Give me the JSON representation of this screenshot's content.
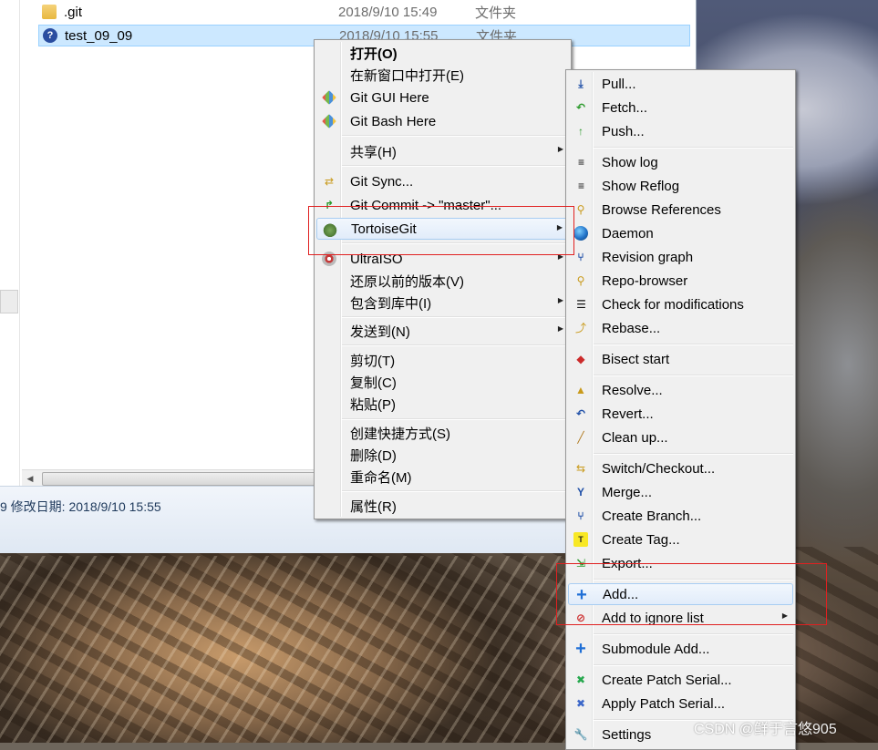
{
  "explorer": {
    "files": [
      {
        "name": ".git",
        "date": "2018/9/10 15:49",
        "type": "文件夹",
        "icon": "folder-icon"
      },
      {
        "name": "test_09_09",
        "date": "2018/9/10 15:55",
        "type": "文件夹",
        "icon": "git-file-icon"
      }
    ],
    "details_text": "9  修改日期: 2018/9/10 15:55"
  },
  "context_menu": {
    "items": [
      {
        "label": "打开(O)",
        "bold": true
      },
      {
        "label": "在新窗口中打开(E)"
      },
      {
        "label": "Git GUI Here",
        "icon": "git-gui-icon"
      },
      {
        "label": "Git Bash Here",
        "icon": "git-bash-icon"
      },
      {
        "label": "共享(H)",
        "submenu": true
      },
      {
        "label": "Git Sync...",
        "icon": "git-sync-icon"
      },
      {
        "label": "Git Commit -> \"master\"...",
        "icon": "git-commit-icon"
      },
      {
        "label": "TortoiseGit",
        "icon": "tortoisegit-icon",
        "submenu": true,
        "highlighted": true
      },
      {
        "label": "UltraISO",
        "icon": "ultraiso-icon",
        "submenu": true
      },
      {
        "label": "还原以前的版本(V)"
      },
      {
        "label": "包含到库中(I)",
        "submenu": true
      },
      {
        "label": "发送到(N)",
        "submenu": true
      },
      {
        "label": "剪切(T)"
      },
      {
        "label": "复制(C)"
      },
      {
        "label": "粘贴(P)"
      },
      {
        "label": "创建快捷方式(S)"
      },
      {
        "label": "删除(D)"
      },
      {
        "label": "重命名(M)"
      },
      {
        "label": "属性(R)"
      }
    ]
  },
  "tortoisegit_menu": {
    "items": [
      {
        "label": "Pull...",
        "icon": "pull-icon"
      },
      {
        "label": "Fetch...",
        "icon": "fetch-icon"
      },
      {
        "label": "Push...",
        "icon": "push-icon"
      },
      {
        "label": "Show log",
        "icon": "show-log-icon"
      },
      {
        "label": "Show Reflog",
        "icon": "show-reflog-icon"
      },
      {
        "label": "Browse References",
        "icon": "browse-references-icon"
      },
      {
        "label": "Daemon",
        "icon": "daemon-globe-icon"
      },
      {
        "label": "Revision graph",
        "icon": "revision-graph-icon"
      },
      {
        "label": "Repo-browser",
        "icon": "repo-browser-icon"
      },
      {
        "label": "Check for modifications",
        "icon": "check-modifications-icon"
      },
      {
        "label": "Rebase...",
        "icon": "rebase-icon"
      },
      {
        "label": "Bisect start",
        "icon": "bisect-icon"
      },
      {
        "label": "Resolve...",
        "icon": "resolve-icon"
      },
      {
        "label": "Revert...",
        "icon": "revert-icon"
      },
      {
        "label": "Clean up...",
        "icon": "cleanup-broom-icon"
      },
      {
        "label": "Switch/Checkout...",
        "icon": "switch-checkout-icon"
      },
      {
        "label": "Merge...",
        "icon": "merge-icon"
      },
      {
        "label": "Create Branch...",
        "icon": "create-branch-icon"
      },
      {
        "label": "Create Tag...",
        "icon": "create-tag-icon"
      },
      {
        "label": "Export...",
        "icon": "export-icon"
      },
      {
        "label": "Add...",
        "icon": "add-plus-icon",
        "highlighted": true
      },
      {
        "label": "Add to ignore list",
        "icon": "ignore-icon",
        "submenu": true
      },
      {
        "label": "Submodule Add...",
        "icon": "submodule-add-icon"
      },
      {
        "label": "Create Patch Serial...",
        "icon": "create-patch-icon"
      },
      {
        "label": "Apply Patch Serial...",
        "icon": "apply-patch-icon"
      },
      {
        "label": "Settings",
        "icon": "settings-wrench-icon"
      }
    ]
  },
  "watermark": "CSDN @鲜于言悠905",
  "colors": {
    "selection": "#cce8ff",
    "menu_bg": "#f0f0f0",
    "highlight_border": "#a8cdf2",
    "annotation_red": "#e02020"
  }
}
